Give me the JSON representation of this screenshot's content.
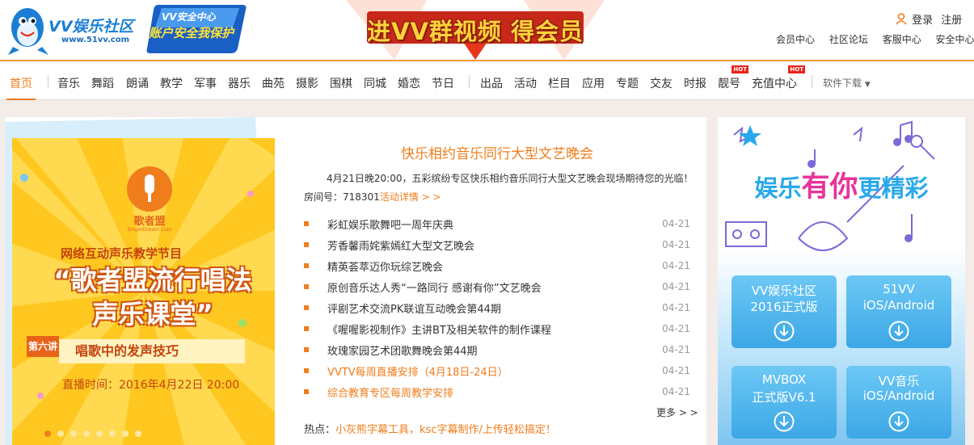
{
  "header": {
    "logo_title": "VV娱乐社区",
    "logo_url": "www.51vv.com",
    "badge_line1": "VV安全中心",
    "badge_line2": "账户安全我保护",
    "banner_text": "进VV群视频 得会员",
    "login": "登录",
    "register": "注册",
    "top_links": [
      "会员中心",
      "社区论坛",
      "客服中心",
      "安全中心"
    ]
  },
  "nav": {
    "items": [
      "首页",
      "音乐",
      "舞蹈",
      "朗诵",
      "教学",
      "军事",
      "器乐",
      "曲苑",
      "摄影",
      "围棋",
      "同城",
      "婚恋",
      "节日",
      "出品",
      "活动",
      "栏目",
      "应用",
      "专题",
      "交友",
      "时报",
      "靓号",
      "充值中心"
    ],
    "hot_label": "HOT",
    "download": "软件下载"
  },
  "poster": {
    "logo_name": "歌者盟",
    "logo_sub": "SingerDream.Com",
    "subtitle": "网络互动声乐教学节目",
    "title": "“歌者盟流行唱法声乐课堂”",
    "lecture_no": "第六讲",
    "lecture_topic": "唱歌中的发声技巧",
    "time": "直播时间：2016年4月22日  20:00",
    "dots": 8,
    "active_dot": 0
  },
  "news": {
    "title": "快乐相约音乐同行大型文艺晚会",
    "intro": "4月21日晚20:00，五彩缤纷专区快乐相约音乐同行大型文艺晚会现场期待您的光临！",
    "room_label": "房间号：718301",
    "room_link": "活动详情 > >",
    "items": [
      {
        "title": "彩虹娱乐歌舞吧一周年庆典",
        "date": "04-21",
        "hl": false
      },
      {
        "title": "芳香馨雨姹紫嫣红大型文艺晚会",
        "date": "04-21",
        "hl": false
      },
      {
        "title": "精英荟萃迈你玩综艺晚会",
        "date": "04-21",
        "hl": false
      },
      {
        "title": "原创音乐达人秀“一路同行 感谢有你”文艺晚会",
        "date": "04-21",
        "hl": false
      },
      {
        "title": "评剧艺术交流PK联谊互动晚会第44期",
        "date": "04-21",
        "hl": false
      },
      {
        "title": "《喔喔影视制作》主讲BT及相关软件的制作课程",
        "date": "04-21",
        "hl": false
      },
      {
        "title": "玫瑰家园艺术团歌舞晚会第44期",
        "date": "04-21",
        "hl": false
      },
      {
        "title": "VVTV每周直播安排（4月18日-24日）",
        "date": "04-21",
        "hl": true
      },
      {
        "title": "综合教育专区每周教学安排",
        "date": "04-21",
        "hl": true
      }
    ],
    "more": "更多 > >",
    "hot_label": "热点：",
    "hot_link": "小灰熊字幕工具，ksc字幕制作/上传轻松搞定！"
  },
  "right": {
    "slogan_left": "娱乐",
    "slogan_mid": "有你",
    "slogan_right": "更精彩",
    "downloads": [
      {
        "line1": "VV娱乐社区",
        "line2": "2016正式版"
      },
      {
        "line1": "51VV",
        "line2": "iOS/Android"
      },
      {
        "line1": "MVBOX",
        "line2": "正式版V6.1"
      },
      {
        "line1": "VV音乐",
        "line2": "iOS/Android"
      }
    ]
  }
}
